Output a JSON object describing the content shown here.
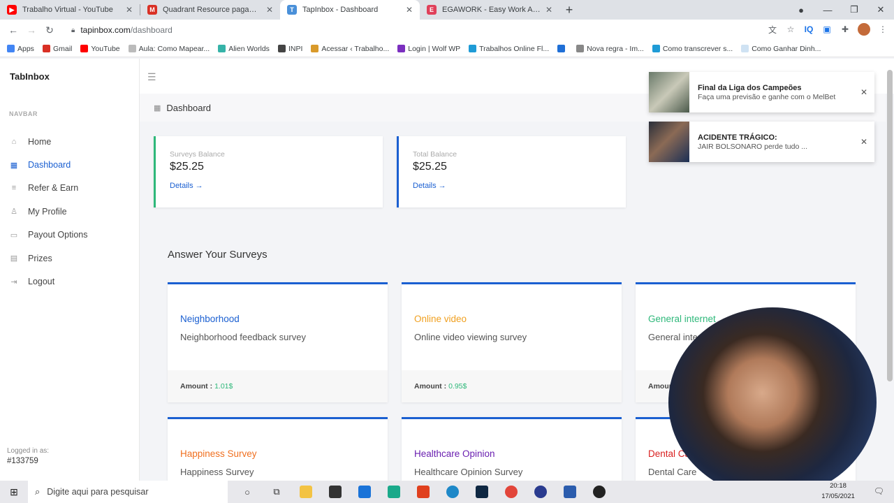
{
  "browser": {
    "tabs": [
      {
        "title": "Trabalho Virtual - YouTube",
        "color": "#ff0000",
        "glyph": "▶"
      },
      {
        "title": "Quadrant Resource pagamento",
        "color": "#d93025",
        "glyph": "M"
      },
      {
        "title": "TapInbox - Dashboard",
        "color": "#4a90d9",
        "glyph": "T"
      },
      {
        "title": "EGAWORK - Easy Work At Home",
        "color": "#e0405a",
        "glyph": "E"
      }
    ],
    "url_host": "tapinbox.com",
    "url_path": "/dashboard",
    "bookmarks": [
      {
        "label": "Apps",
        "color": "#4285f4"
      },
      {
        "label": "Gmail",
        "color": "#d93025"
      },
      {
        "label": "YouTube",
        "color": "#ff0000"
      },
      {
        "label": "Aula: Como Mapear...",
        "color": "#bbbbbb"
      },
      {
        "label": "Alien Worlds",
        "color": "#36b3a8"
      },
      {
        "label": "INPI",
        "color": "#444444"
      },
      {
        "label": "Acessar ‹ Trabalho...",
        "color": "#d99a2b"
      },
      {
        "label": "Login | Wolf WP",
        "color": "#7b2fbf"
      },
      {
        "label": "Trabalhos Online Fl...",
        "color": "#1f9bd6"
      },
      {
        "label": "",
        "color": "#1f6fd6"
      },
      {
        "label": "Nova regra - Im...",
        "color": "#888888"
      },
      {
        "label": "Como transcrever s...",
        "color": "#1f9bd6"
      },
      {
        "label": "Como Ganhar Dinh...",
        "color": "#cfe2f3"
      }
    ]
  },
  "app": {
    "brand": "TabInbox",
    "nav_label": "NAVBAR",
    "menu": [
      {
        "label": "Home",
        "icon": "⌂"
      },
      {
        "label": "Dashboard",
        "icon": "▦"
      },
      {
        "label": "Refer & Earn",
        "icon": "≡"
      },
      {
        "label": "My Profile",
        "icon": "♙"
      },
      {
        "label": "Payout Options",
        "icon": "▭"
      },
      {
        "label": "Prizes",
        "icon": "▤"
      },
      {
        "label": "Logout",
        "icon": "⇥"
      }
    ],
    "logged_label": "Logged in as:",
    "user_id": "#133759",
    "breadcrumb": "Dashboard",
    "balances": [
      {
        "label": "Surveys Balance",
        "value": "$25.25",
        "link": "Details →",
        "accent": "#2eb87a"
      },
      {
        "label": "Total Balance",
        "value": "$25.25",
        "link": "Details →",
        "accent": "#1a5fd1"
      }
    ],
    "section_title": "Answer Your Surveys",
    "surveys": [
      {
        "name": "Neighborhood",
        "desc": "Neighborhood feedback survey",
        "amount_label": "Amount :",
        "amount": "1.01$",
        "color": "#1a5fd1"
      },
      {
        "name": "Online video",
        "desc": "Online video viewing survey",
        "amount_label": "Amount :",
        "amount": "0.95$",
        "color": "#f0a020"
      },
      {
        "name": "General internet",
        "desc": "General internet",
        "amount_label": "Amount :",
        "amount": "",
        "color": "#2eb87a"
      },
      {
        "name": "Happiness Survey",
        "desc": "Happiness Survey",
        "color": "#f07020"
      },
      {
        "name": "Healthcare Opinion",
        "desc": "Healthcare Opinion Survey",
        "color": "#6a1fb0"
      },
      {
        "name": "Dental Care",
        "desc": "Dental Care",
        "color": "#d92020"
      }
    ],
    "notifications": [
      {
        "title": "Final da Liga dos Campeões",
        "text": "Faça uma previsão e ganhe com o MelBet"
      },
      {
        "title": "ACIDENTE TRÁGICO:",
        "text": "JAIR BOLSONARO perde tudo ..."
      }
    ]
  },
  "taskbar": {
    "search_placeholder": "Digite aqui para pesquisar",
    "time": "20:18",
    "date": "17/05/2021"
  }
}
